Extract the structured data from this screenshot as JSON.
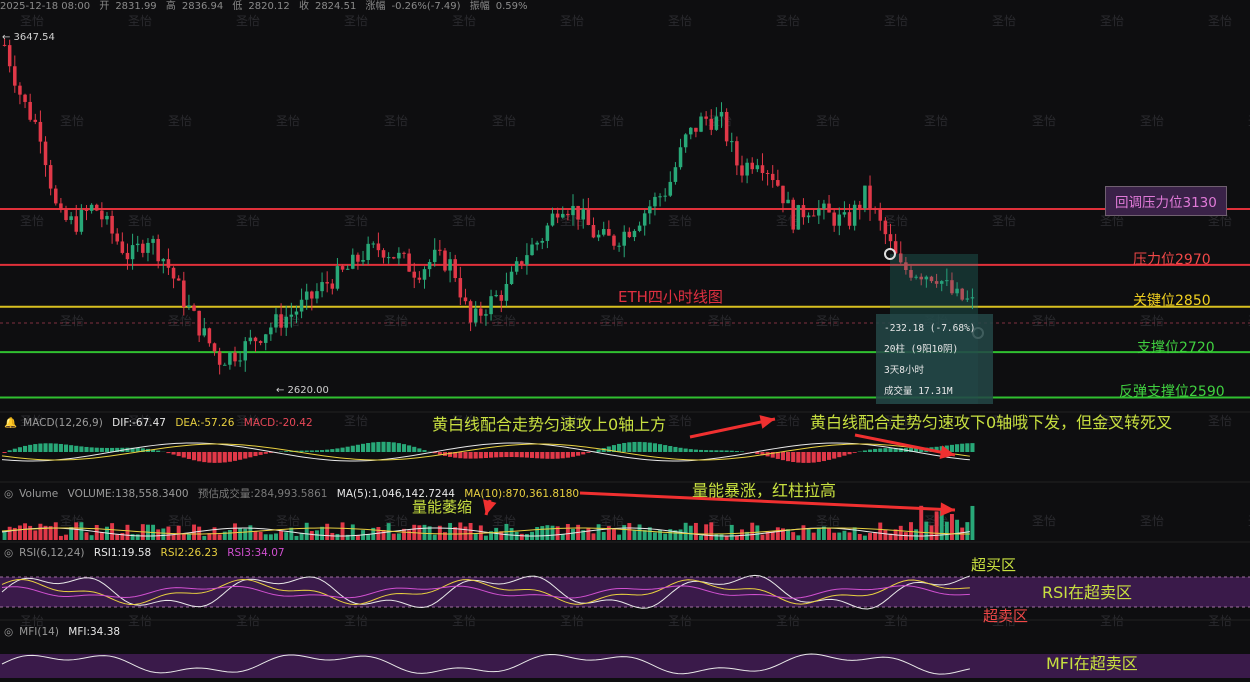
{
  "header": {
    "date": "2025-12-18 08:00",
    "open_label": "开",
    "open": "2831.99",
    "high_label": "高",
    "high": "2836.94",
    "low_label": "低",
    "low": "2820.12",
    "close_label": "收",
    "close": "2824.51",
    "chg_label": "涨幅",
    "chg": "-0.26%(-7.49)",
    "amp_label": "振幅",
    "amp": "0.59%"
  },
  "chart_title": "ETH四小时线图",
  "max_label": "← 3647.54",
  "min_label": "← 2620.00",
  "levels": [
    {
      "name": "回调压力位3130",
      "price": 3130,
      "color": "#e0303a",
      "text_color": "#e878d8"
    },
    {
      "name": "压力位2970",
      "price": 2970,
      "color": "#e0303a",
      "text_color": "#f04848"
    },
    {
      "name": "关键位2850",
      "price": 2850,
      "color": "#d8c020",
      "text_color": "#f0d020"
    },
    {
      "name": "支撑位2720",
      "price": 2720,
      "color": "#30c030",
      "text_color": "#40d040"
    },
    {
      "name": "反弹支撑位2590",
      "price": 2590,
      "color": "#30c030",
      "text_color": "#40d040"
    }
  ],
  "measure": {
    "change": "-232.18 (-7.68%)",
    "bars": "20柱 (9阳10阴)",
    "duration": "3天8小时",
    "volume": "成交量 17.31M"
  },
  "macd": {
    "name": "MACD(12,26,9)",
    "dif": "DIF:-67.47",
    "dea": "DEA:-57.26",
    "macd": "MACD:-20.42"
  },
  "volume": {
    "name": "Volume",
    "vol": "VOLUME:138,558.3400",
    "est": "预估成交量:284,993.5861",
    "ma5": "MA(5):1,046,142.7244",
    "ma10": "MA(10):870,361.8180"
  },
  "rsi": {
    "name": "RSI(6,12,24)",
    "r1": "RSI1:19.58",
    "r2": "RSI2:26.23",
    "r3": "RSI3:34.07"
  },
  "mfi": {
    "name": "MFI(14)",
    "v": "MFI:34.38"
  },
  "annotations": {
    "macd_left": "黄白线配合走势匀速攻上0轴上方",
    "macd_right": "黄白线配合走势匀速攻下0轴哦下发，但金叉转死叉",
    "vol_up": "量能暴涨，红柱拉高",
    "vol_shrink": "量能萎缩",
    "overbought": "超买区",
    "rsi_oversold_zone": "RSI在超卖区",
    "oversold": "超卖区",
    "mfi_oversold": "MFI在超卖区"
  },
  "watermark": "圣怡",
  "colors": {
    "up": "#28a878",
    "down": "#e03848",
    "bg": "#0e0e10"
  },
  "chart_data": {
    "type": "candlestick",
    "symbol": "ETH",
    "interval": "4h",
    "ylim": [
      2540,
      3700
    ],
    "high_point": 3647.54,
    "low_point": 2620.0,
    "close_path": [
      3600,
      3440,
      3350,
      3100,
      3090,
      3140,
      3060,
      2990,
      3050,
      2980,
      2870,
      2780,
      2700,
      2720,
      2760,
      2800,
      2830,
      2870,
      2920,
      2950,
      3000,
      3020,
      2990,
      2950,
      2990,
      2970,
      2800,
      2860,
      2900,
      3000,
      3050,
      3150,
      3120,
      3050,
      3040,
      3080,
      3140,
      3190,
      3330,
      3390,
      3380,
      3240,
      3280,
      3220,
      3100,
      3140,
      3110,
      3090,
      3170,
      3070,
      2960,
      2950,
      2940,
      2880,
      2860
    ],
    "series": [
      {
        "name": "MA5"
      },
      {
        "name": "MA10"
      }
    ]
  }
}
